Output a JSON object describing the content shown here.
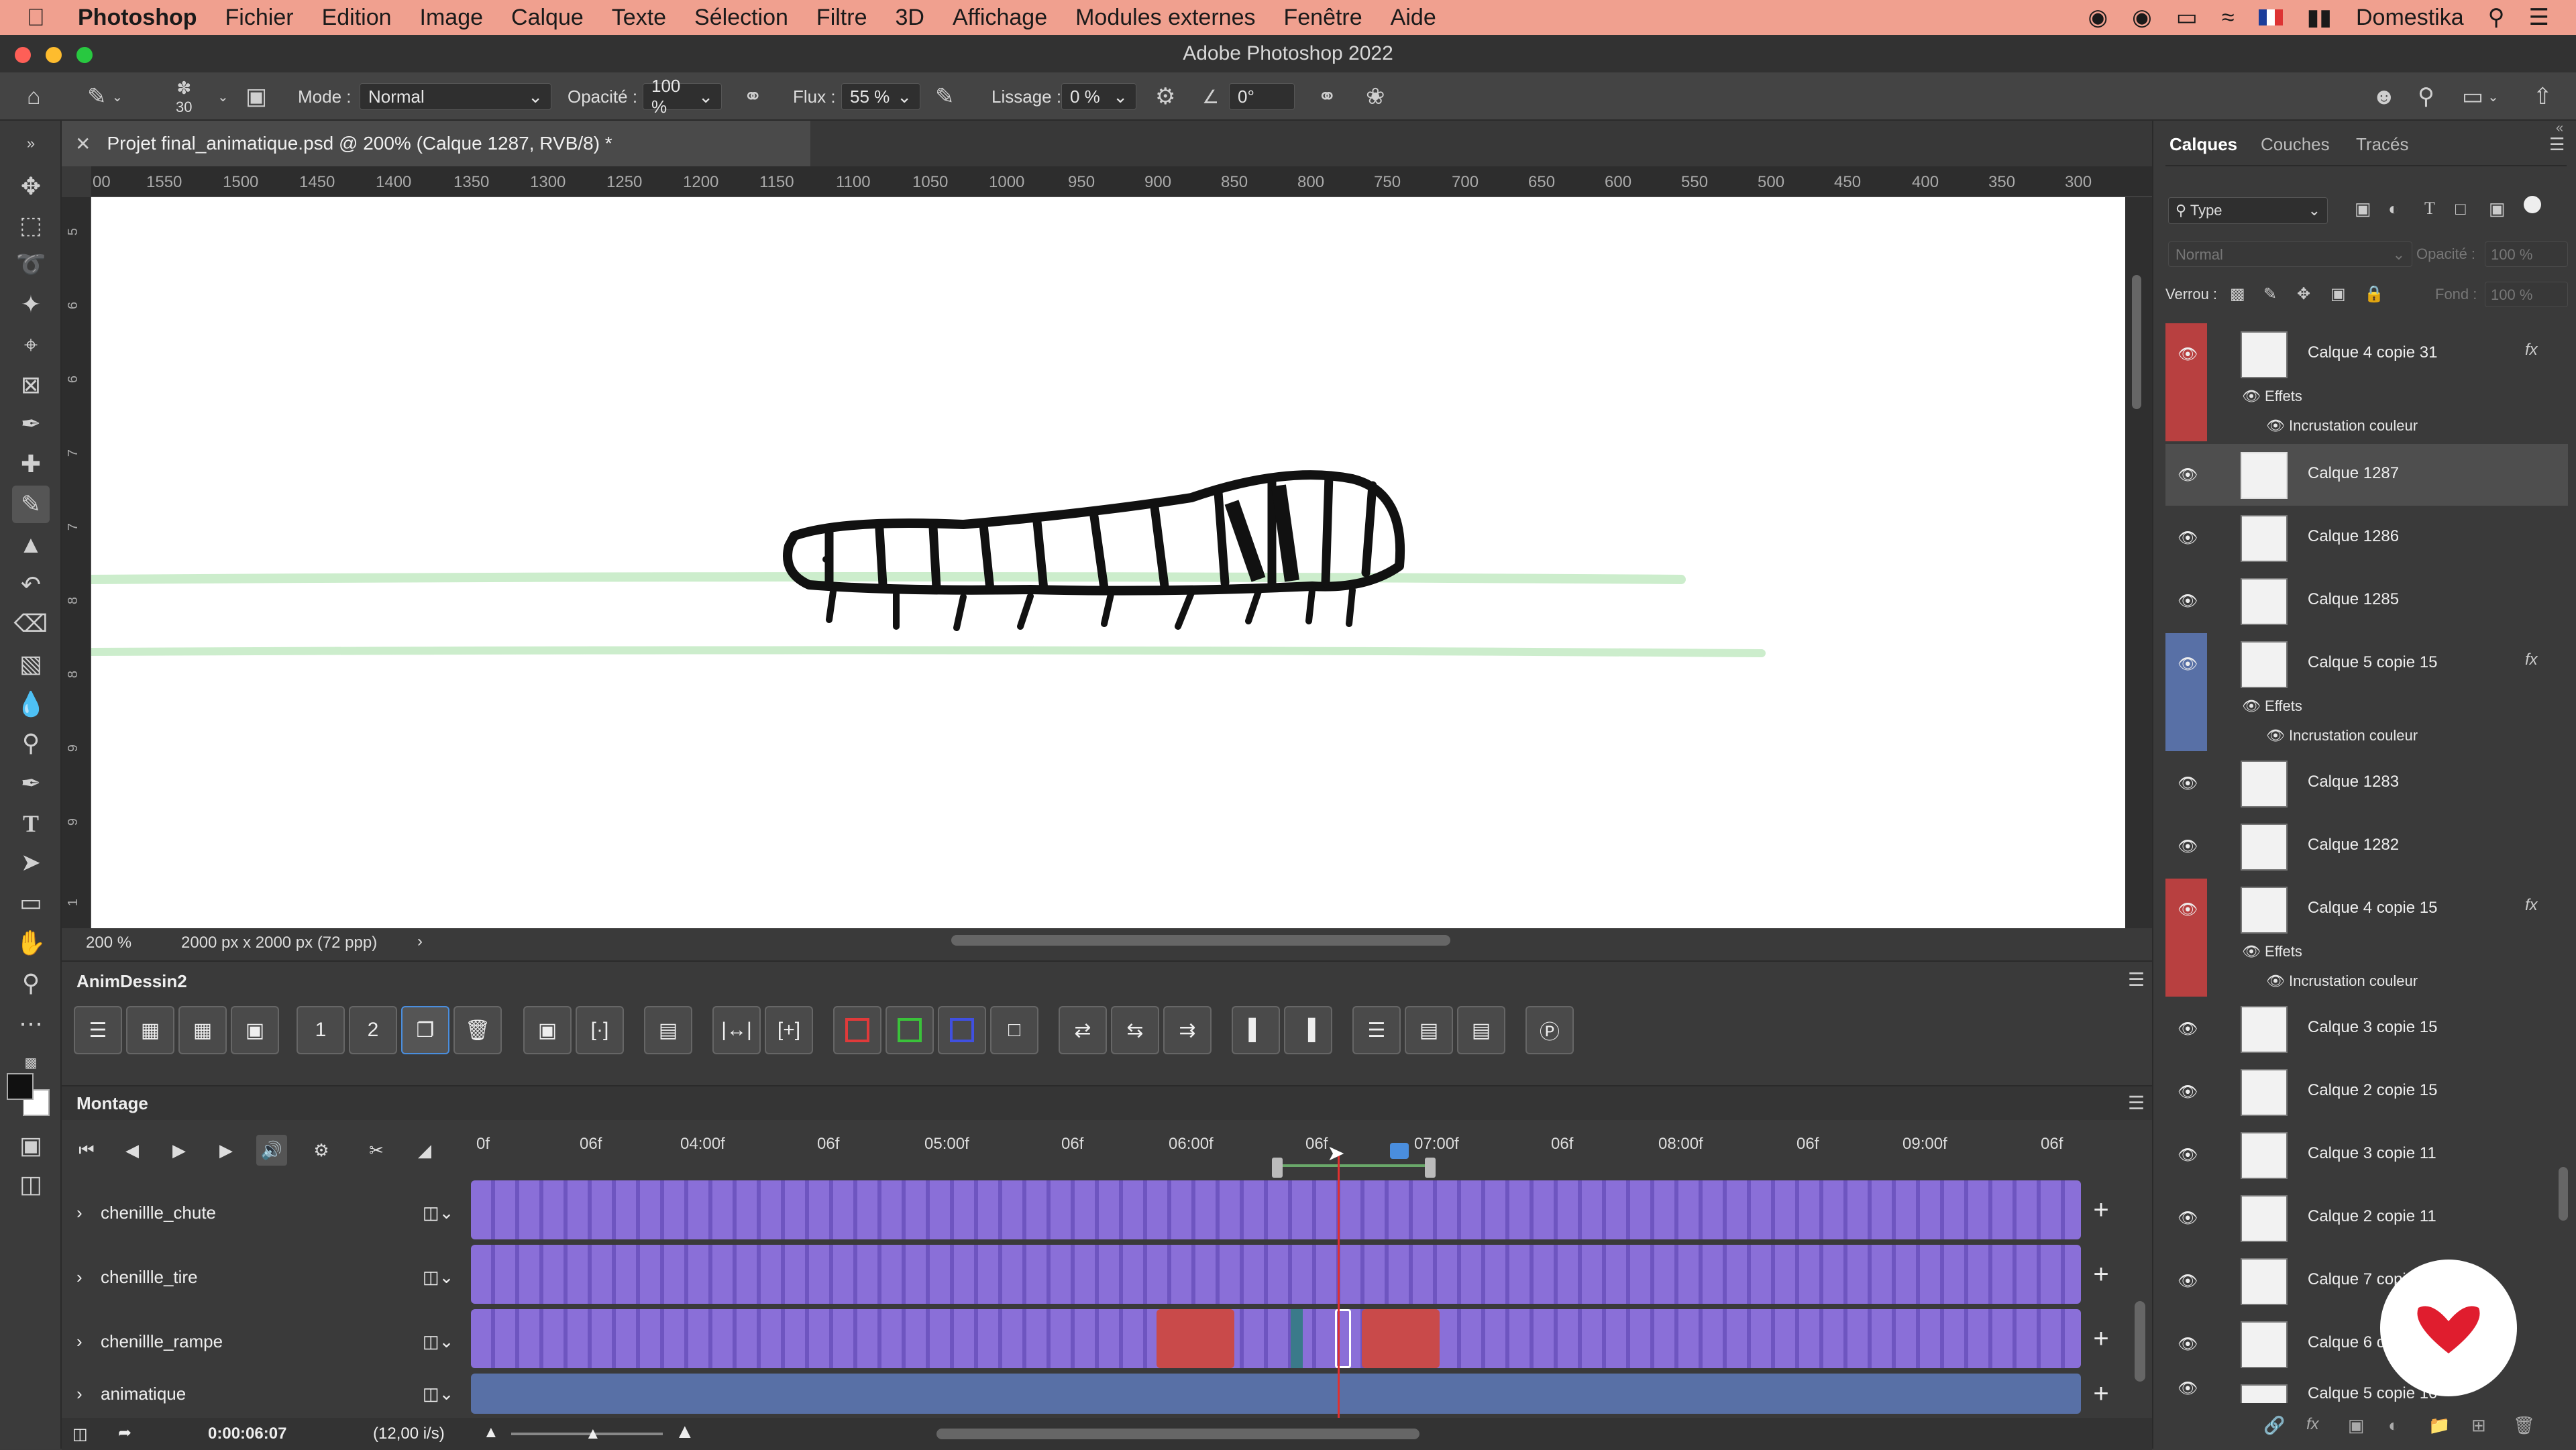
{
  "menubar": {
    "app": "Photoshop",
    "items": [
      "Fichier",
      "Edition",
      "Image",
      "Calque",
      "Texte",
      "Sélection",
      "Filtre",
      "3D",
      "Affichage",
      "Modules externes",
      "Fenêtre",
      "Aide"
    ],
    "user": "Domestika"
  },
  "window": {
    "title": "Adobe Photoshop 2022"
  },
  "options": {
    "brush_size": "30",
    "mode_label": "Mode :",
    "mode_value": "Normal",
    "opacity_label": "Opacité :",
    "opacity_value": "100 %",
    "flux_label": "Flux :",
    "flux_value": "55 %",
    "smoothing_label": "Lissage :",
    "smoothing_value": "0 %",
    "angle_value": "0°"
  },
  "document": {
    "tab_title": "Projet final_animatique.psd @ 200% (Calque 1287, RVB/8) *",
    "zoom": "200 %",
    "doc_size": "2000 px x 2000 px (72 ppp)"
  },
  "ruler": {
    "h_labels": [
      "00",
      "1550",
      "1500",
      "1450",
      "1400",
      "1350",
      "1300",
      "1250",
      "1200",
      "1150",
      "1100",
      "1050",
      "1000",
      "950",
      "900",
      "850",
      "800",
      "750",
      "700",
      "650",
      "600",
      "550",
      "500",
      "450",
      "400",
      "350",
      "300"
    ],
    "v_labels": [
      "5",
      "6",
      "6",
      "7",
      "7",
      "8",
      "8",
      "9",
      "9",
      "1"
    ]
  },
  "anim_panel": {
    "title": "AnimDessin2"
  },
  "timeline": {
    "title": "Montage",
    "ruler_labels": [
      "0f",
      "06f",
      "04:00f",
      "06f",
      "05:00f",
      "06f",
      "06:00f",
      "06f",
      "07:00f",
      "06f",
      "08:00f",
      "06f",
      "09:00f",
      "06f"
    ],
    "tracks": [
      "chenillle_chute",
      "chenillle_tire",
      "chenillle_rampe",
      "animatique"
    ],
    "current_time": "0:00:06:07",
    "fps": "(12,00 i/s)"
  },
  "layers_panel": {
    "tabs": [
      "Calques",
      "Couches",
      "Tracés"
    ],
    "filter_label": "Type",
    "blend_mode": "Normal",
    "opacity_label": "Opacité :",
    "opacity_value": "100 %",
    "lock_label": "Verrou :",
    "fill_label": "Fond :",
    "fill_value": "100 %",
    "effects_label": "Effets",
    "effect_name": "Incrustation couleur",
    "layers": [
      {
        "name": "Calque 4 copie 31",
        "fx": "fx"
      },
      {
        "name": "Calque 1287"
      },
      {
        "name": "Calque 1286"
      },
      {
        "name": "Calque 1285"
      },
      {
        "name": "Calque 5 copie 15",
        "fx": "fx"
      },
      {
        "name": "Calque 1283"
      },
      {
        "name": "Calque 1282"
      },
      {
        "name": "Calque 4 copie 15",
        "fx": "fx"
      },
      {
        "name": "Calque 3 copie 15"
      },
      {
        "name": "Calque 2 copie 15"
      },
      {
        "name": "Calque 3 copie 11"
      },
      {
        "name": "Calque 2 copie 11"
      },
      {
        "name": "Calque 7 copi"
      },
      {
        "name": "Calque 6 co"
      },
      {
        "name": "Calque 5 copie 10"
      }
    ]
  },
  "colors": {
    "menubar": "#f0a08f",
    "red_flag": "#b84040",
    "blue_flag": "#5870a6",
    "track_purple": "#8a6fd8",
    "clip_red": "#c94a4a",
    "playhead": "#e03030"
  }
}
